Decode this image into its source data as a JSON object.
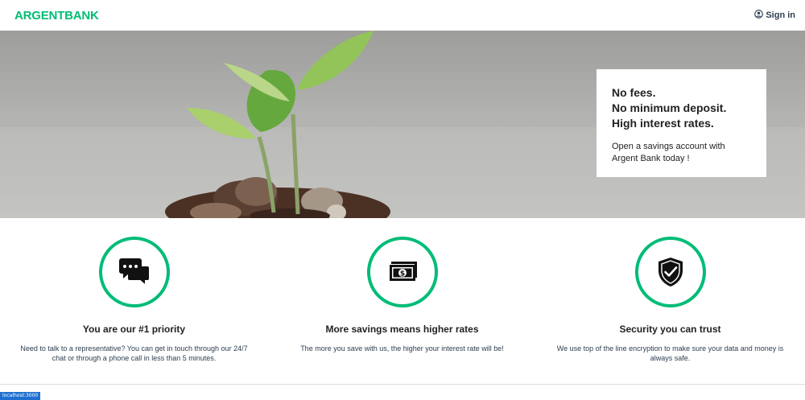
{
  "nav": {
    "logo_part1": "ARGENT",
    "logo_part2": "BANK",
    "signin_label": "Sign in",
    "signin_icon": "user-circle-icon"
  },
  "hero": {
    "subtitles": [
      "No fees.",
      "No minimum deposit.",
      "High interest rates."
    ],
    "text": "Open a savings account with Argent Bank today !"
  },
  "features": [
    {
      "icon": "chat-icon",
      "title": "You are our #1 priority",
      "text": "Need to talk to a representative? You can get in touch through our 24/7 chat or through a phone call in less than 5 minutes."
    },
    {
      "icon": "money-icon",
      "title": "More savings means higher rates",
      "text": "The more you save with us, the higher your interest rate will be!"
    },
    {
      "icon": "security-icon",
      "title": "Security you can trust",
      "text": "We use top of the line encryption to make sure your data and money is always safe."
    }
  ],
  "status_bar": "localhost:3000",
  "colors": {
    "accent": "#00bc77",
    "text": "#2c3e50"
  }
}
